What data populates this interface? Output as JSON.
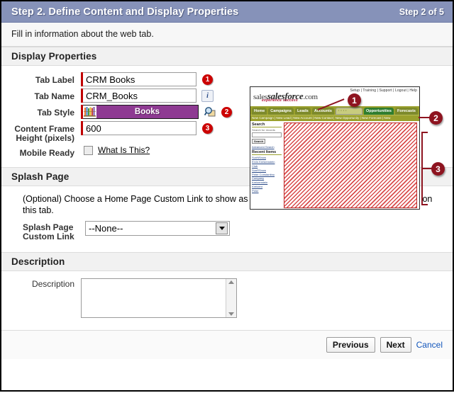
{
  "header": {
    "title": "Step 2. Define Content and Display Properties",
    "step_counter": "Step 2 of 5",
    "instruction": "Fill in information about the web tab.",
    "accent_color": "#8692b9"
  },
  "sections": {
    "display_properties": {
      "heading": "Display Properties",
      "fields": {
        "tab_label": {
          "label": "Tab Label",
          "value": "CRM Books",
          "badge": "1"
        },
        "tab_name": {
          "label": "Tab Name",
          "value": "CRM_Books",
          "info_icon": "i"
        },
        "tab_style": {
          "label": "Tab Style",
          "value": "Books",
          "badge": "2",
          "style_color": "#8e3a92",
          "icon": "books-icon"
        },
        "content_frame_height": {
          "label": "Content Frame Height (pixels)",
          "value": "600",
          "badge": "3"
        },
        "mobile_ready": {
          "label": "Mobile Ready",
          "checked": false,
          "link_text": "What Is This?"
        }
      }
    },
    "splash_page": {
      "heading": "Splash Page",
      "description": "(Optional) Choose a Home Page Custom Link to show as a splash page the first time your users click on this tab.",
      "field": {
        "label": "Splash Page Custom Link",
        "selected": "--None--",
        "options": [
          "--None--"
        ]
      }
    },
    "description": {
      "heading": "Description",
      "field": {
        "label": "Description",
        "value": ""
      }
    }
  },
  "footer": {
    "previous_label": "Previous",
    "next_label": "Next",
    "cancel_label": "Cancel"
  },
  "preview": {
    "logo_main": "salesforce",
    "logo_suffix": ".com",
    "logo_prefix": "sales",
    "tagline": "experience success",
    "top_links": "Setup | Training | Support | Logout | Help",
    "tabs": [
      "Home",
      "Campaigns",
      "Leads",
      "Accounts",
      "· · · ·",
      "Opportunities",
      "Forecasts"
    ],
    "active_tab": "· · · ·",
    "subnav": "New Campaign | New Lead | New Account | New Contact | New Opportunity | New Forecast | New",
    "sidebar": {
      "search_heading": "Search",
      "search_placeholder": "Search for records",
      "search_button": "Search",
      "advanced_link": "Advanced Search",
      "recent_heading": "Recent Items",
      "recent_items": [
        "SunNSnow",
        "Ervin Kretzenstein",
        "Club",
        "SunRSnow",
        "Peter Constantino Company",
        "Kretzenstein",
        "Kretzenr",
        "Peter"
      ]
    }
  },
  "annotations": {
    "callout_2": "2",
    "callout_3": "3",
    "badge_color": "#8e1420"
  }
}
